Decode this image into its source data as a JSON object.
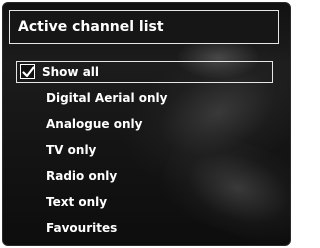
{
  "menu": {
    "title": "Active channel list",
    "items": [
      {
        "label": "Show all",
        "checked": true,
        "selected": true
      },
      {
        "label": "Digital Aerial only"
      },
      {
        "label": "Analogue only"
      },
      {
        "label": "TV only"
      },
      {
        "label": "Radio only"
      },
      {
        "label": "Text only"
      },
      {
        "label": "Favourites"
      }
    ]
  },
  "icons": {
    "checkbox": "checkmark-icon"
  }
}
